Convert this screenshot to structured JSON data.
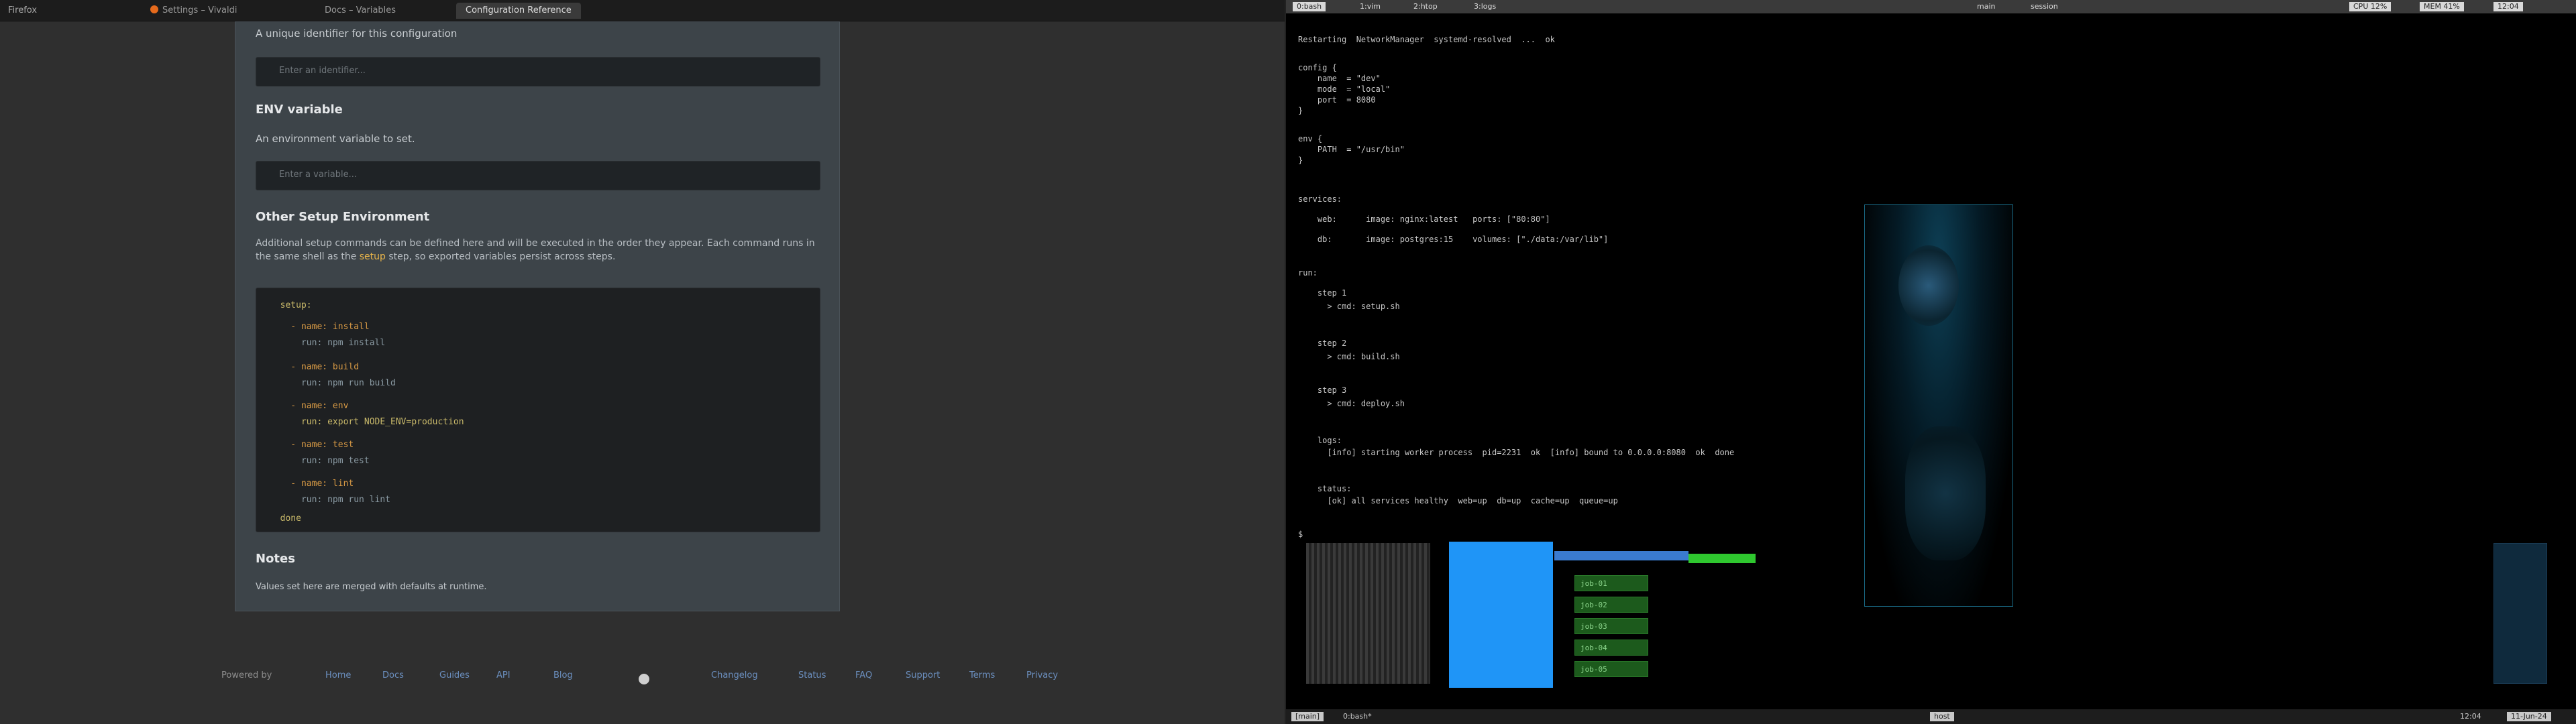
{
  "browser": {
    "menu_label": "Firefox",
    "tabs": [
      {
        "label": "Settings – Vivaldi",
        "active": false
      },
      {
        "label": "Docs – Variables",
        "active": false
      },
      {
        "label": "Configuration Reference",
        "active": true
      }
    ],
    "doc": {
      "intro_text": "A unique identifier for this configuration",
      "input1_placeholder": "Enter an identifier...",
      "section1_title": "ENV variable",
      "section1_text": "An environment variable to set.",
      "input2_placeholder": "Enter a variable...",
      "section2_title": "Other Setup Environment",
      "section2_para": "Additional setup commands can be defined here and will be executed in the order they appear. Each command runs in the same shell as the",
      "section2_code_word": "setup",
      "section2_para_end": "step, so exported variables persist across steps.",
      "code_lines": [
        "  setup:",
        "    - name: install",
        "      run: npm install",
        "    - name: build",
        "      run: npm run build",
        "    - name: env",
        "      run: export NODE_ENV=production",
        "    - name: test",
        "      run: npm test",
        "    - name: lint",
        "      run: npm run lint",
        "  done"
      ],
      "notes_title": "Notes",
      "notes_text": "Values set here are merged with defaults at runtime."
    },
    "footer": {
      "label": "Powered by",
      "links": [
        "Home",
        "Docs",
        "Guides",
        "API",
        "Blog",
        "Changelog",
        "Status",
        "FAQ",
        "Support",
        "Terms",
        "Privacy"
      ]
    }
  },
  "terminal": {
    "tmux_top": [
      "0:bash",
      "1:vim",
      "2:htop",
      "3:logs"
    ],
    "tmux_top_right": [
      "main",
      "session",
      "CPU 12%",
      "MEM 41%",
      "12:04"
    ],
    "lines": [
      "Restarting  NetworkManager  systemd-resolved  ...  ok",
      "",
      "config {",
      "    name  = \"dev\"",
      "    mode  = \"local\"",
      "    port  = 8080",
      "}",
      "",
      "env {",
      "    PATH  = \"/usr/bin\"",
      "}",
      "",
      "services:",
      "    web:      image: nginx:latest   ports: [\"80:80\"]",
      "    db:       image: postgres:15    volumes: [\"./data:/var/lib\"]",
      "",
      "run:",
      "    step 1",
      "      > cmd: setup.sh",
      "",
      "    step 2",
      "      > cmd: build.sh",
      "",
      "    step 3",
      "      > cmd: deploy.sh",
      "",
      "    logs:",
      "      [info] starting worker process  pid=2231  ok  [info] bound to 0.0.0.0:8080  ok  done",
      "",
      "    status:",
      "      [ok] all services healthy  web=up  db=up  cache=up  queue=up",
      "$"
    ],
    "green_cells": [
      "job-01",
      "job-02",
      "job-03",
      "job-04",
      "job-05"
    ],
    "tmux_bottom_left": [
      "[main]",
      "0:bash*"
    ],
    "tmux_bottom_mid": "host",
    "tmux_bottom_right": [
      "12:04",
      "11-Jun-24"
    ]
  }
}
